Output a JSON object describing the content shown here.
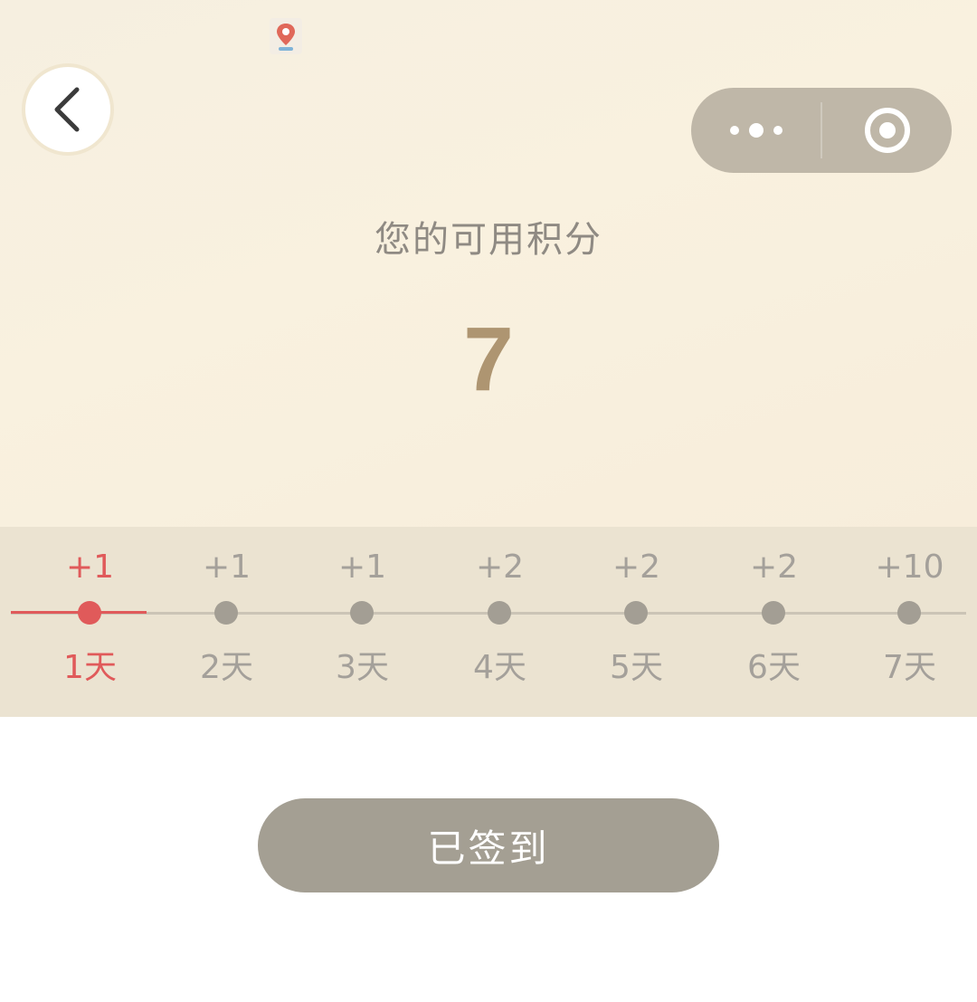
{
  "colors": {
    "accent_red": "#e05a5a",
    "points_gold": "#ae9571",
    "muted_gray": "#a4a09a",
    "button_gray": "#a49f93"
  },
  "nav": {
    "back_icon": "chevron-left-icon",
    "more_icon": "more-dots-icon",
    "close_icon": "target-icon"
  },
  "points": {
    "label": "您的可用积分",
    "value": "7"
  },
  "checkin": {
    "current_day": 1,
    "days": [
      {
        "reward": "+1",
        "day": "1天",
        "active": true
      },
      {
        "reward": "+1",
        "day": "2天",
        "active": false
      },
      {
        "reward": "+1",
        "day": "3天",
        "active": false
      },
      {
        "reward": "+2",
        "day": "4天",
        "active": false
      },
      {
        "reward": "+2",
        "day": "5天",
        "active": false
      },
      {
        "reward": "+2",
        "day": "6天",
        "active": false
      },
      {
        "reward": "+10",
        "day": "7天",
        "active": false
      }
    ]
  },
  "action": {
    "button_label": "已签到"
  }
}
